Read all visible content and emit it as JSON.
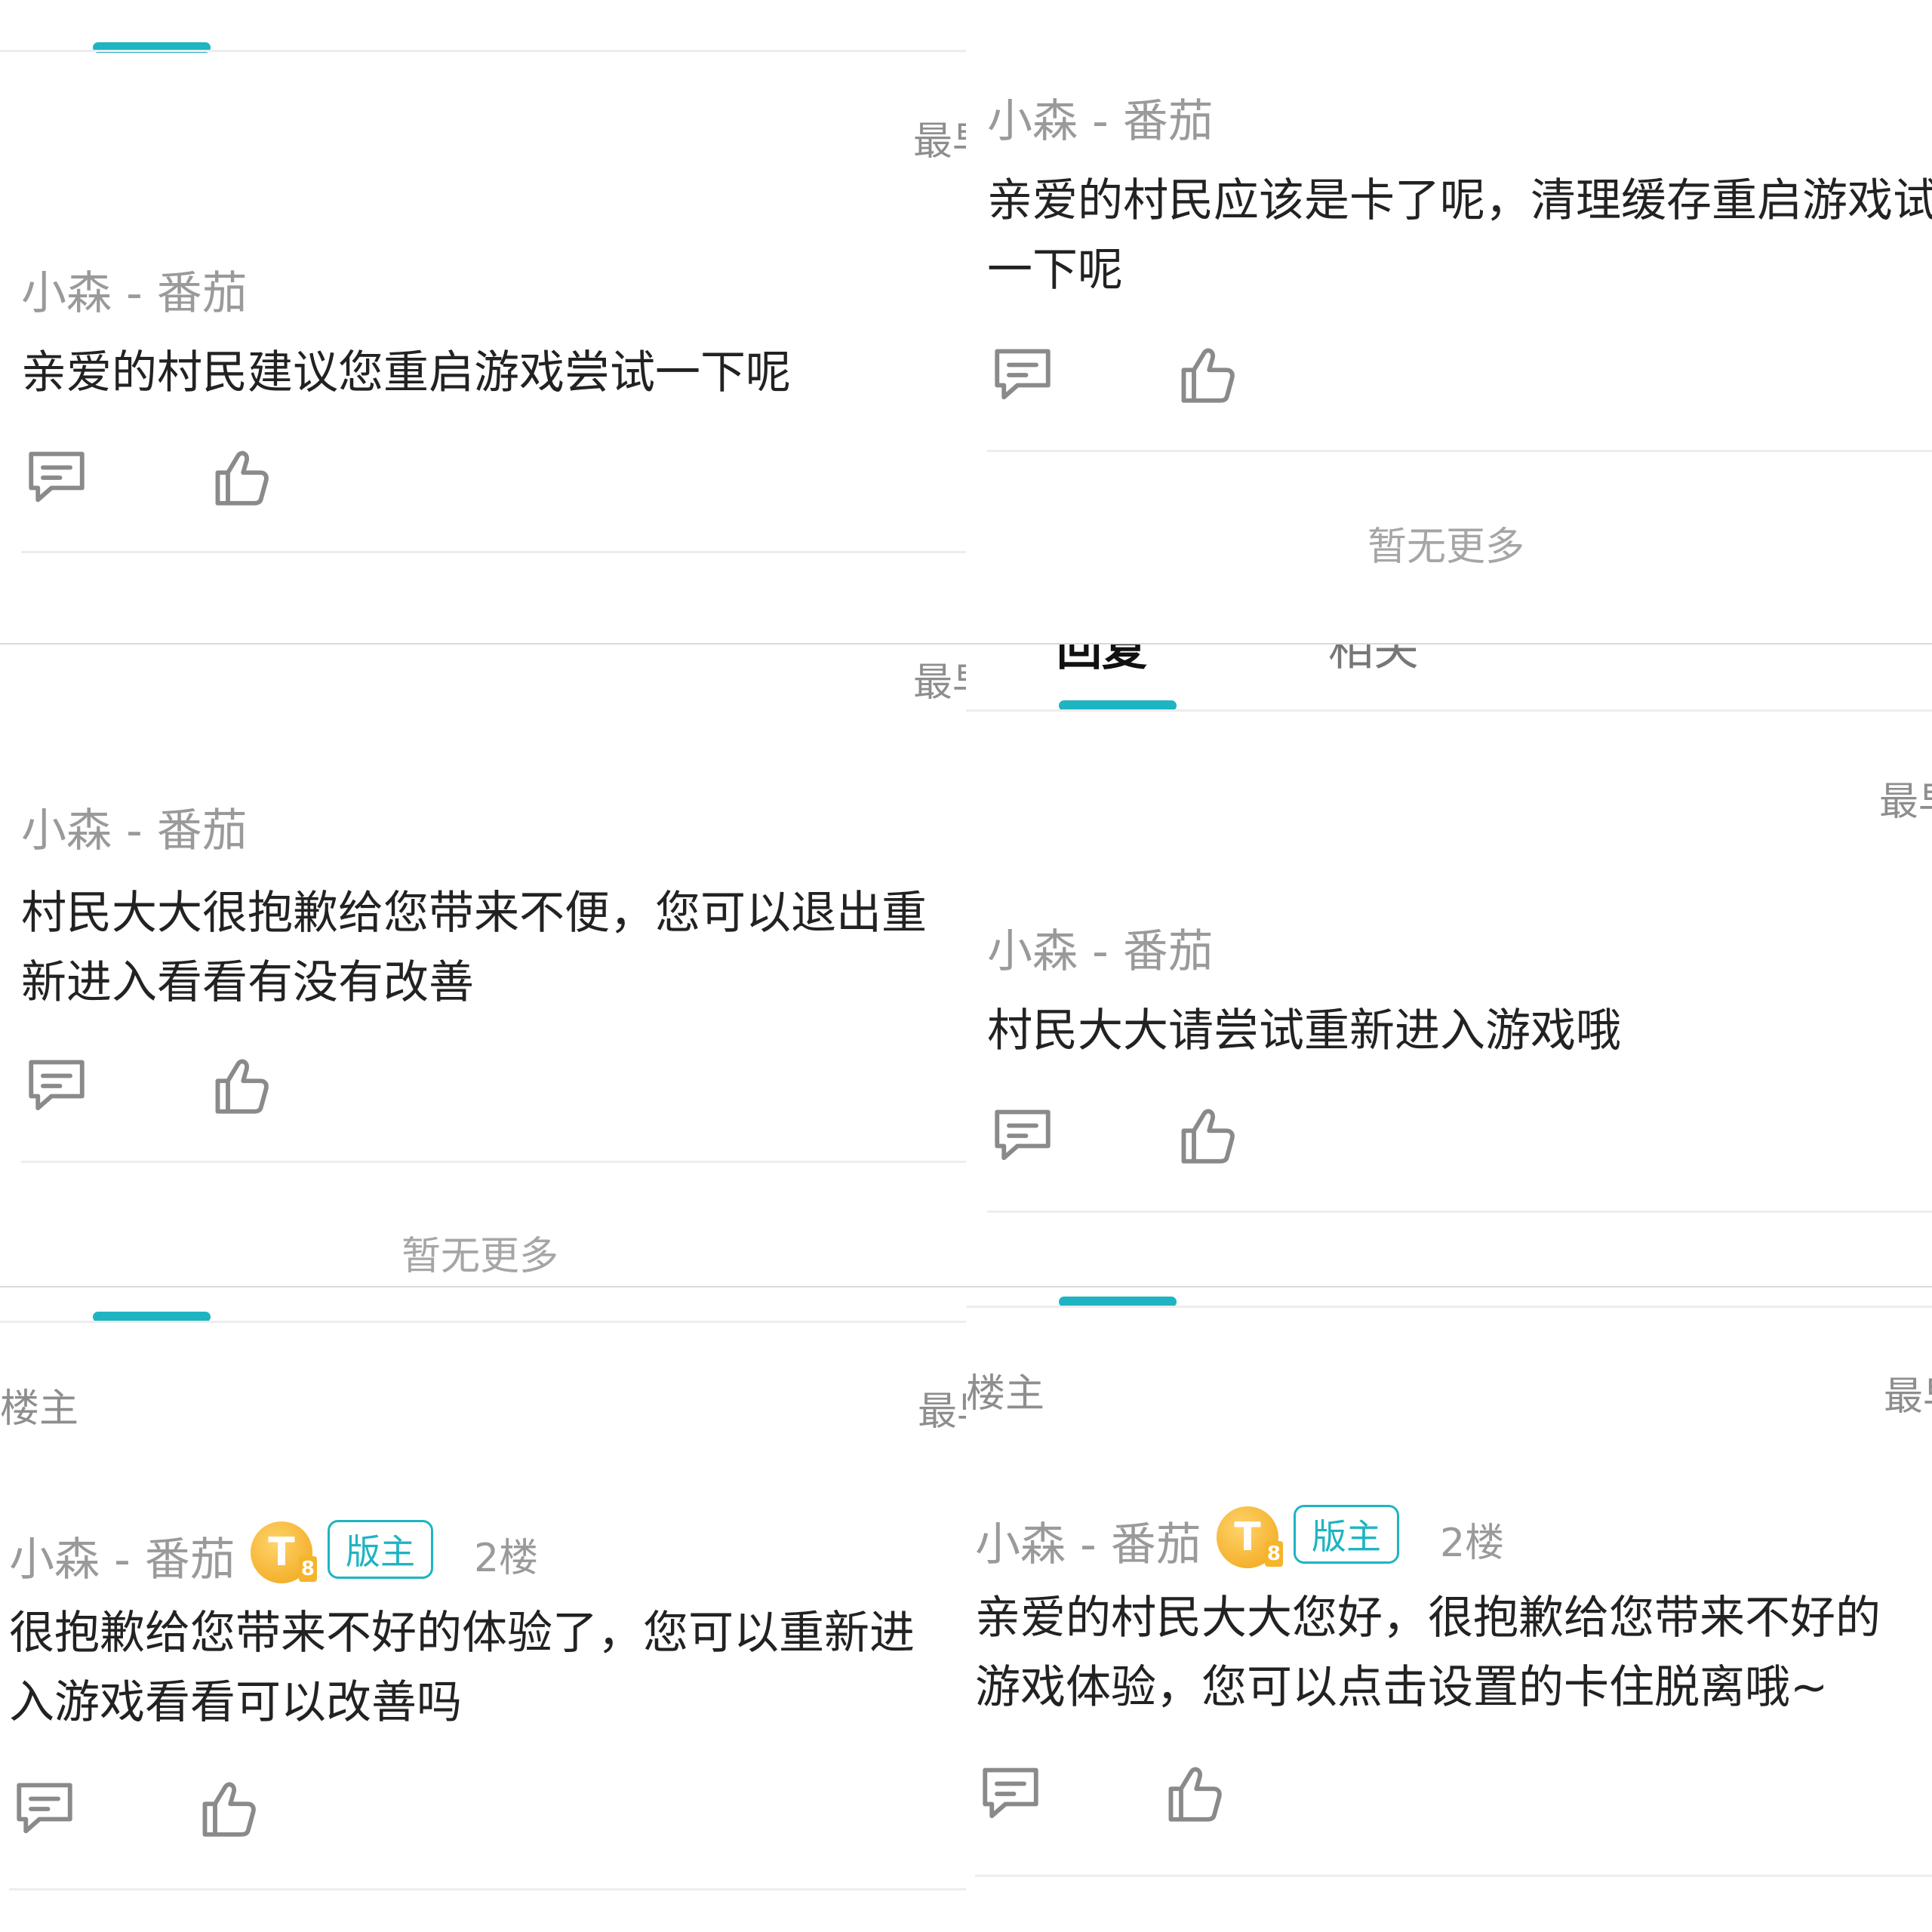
{
  "panels": {
    "p1": {
      "sort_label": "最早",
      "author": "小森 - 番茄",
      "content": "亲爱的村民建议您重启游戏尝试一下呢"
    },
    "p2": {
      "author": "小森 - 番茄",
      "content": "亲爱的村民应该是卡了呢，清理缓存重启游戏试一下呢",
      "footer": "暂无更多"
    },
    "p3": {
      "sort_label": "最早",
      "author": "小森 - 番茄",
      "content": "村民大大很抱歉给您带来不便，您可以退出重新进入看看有没有改善",
      "footer": "暂无更多"
    },
    "p4": {
      "tabs": [
        "回复",
        "相关"
      ],
      "sort_label": "最早",
      "author": "小森 - 番茄",
      "content": "村民大大请尝试重新进入游戏哦"
    },
    "p5": {
      "op_label": "楼主",
      "sort_label": "最早",
      "author": "小森 - 番茄",
      "level_badge": "T",
      "level_num": "8",
      "mod_badge": "版主",
      "floor": "2楼",
      "content": "很抱歉给您带来不好的体验了，您可以重新进入游戏看看可以改善吗"
    },
    "p6": {
      "op_label": "楼主",
      "sort_label": "最早",
      "author": "小森 - 番茄",
      "level_badge": "T",
      "level_num": "8",
      "mod_badge": "版主",
      "floor": "2楼",
      "content": "亲爱的村民大大您好，很抱歉给您带来不好的游戏体验，您可以点击设置的卡住脱离哦~"
    }
  },
  "icons": {
    "comment": "comment-icon",
    "like": "thumbs-up-icon"
  },
  "colors": {
    "accent": "#1fb4c2",
    "divider": "#ededed",
    "text": "#222222",
    "muted": "#9a9a9a"
  }
}
